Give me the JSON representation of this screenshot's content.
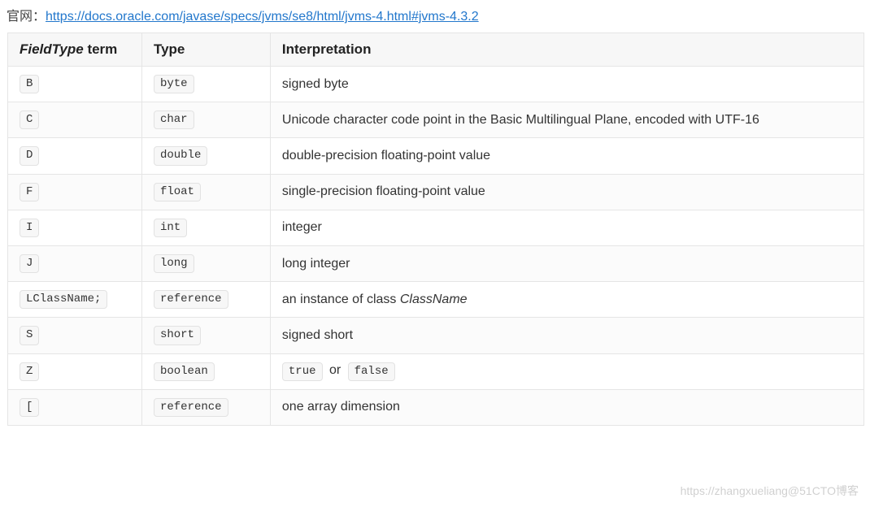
{
  "intro": {
    "prefix": "官网：",
    "link_text": "https://docs.oracle.com/javase/specs/jvms/se8/html/jvms-4.html#jvms-4.3.2",
    "link_href": "https://docs.oracle.com/javase/specs/jvms/se8/html/jvms-4.html#jvms-4.3.2"
  },
  "table": {
    "headers": {
      "col1_italic": "FieldType",
      "col1_rest": " term",
      "col2": "Type",
      "col3": "Interpretation"
    },
    "rows": [
      {
        "term": "B",
        "type": "byte",
        "interp": [
          {
            "t": "text",
            "v": "signed byte"
          }
        ]
      },
      {
        "term": "C",
        "type": "char",
        "interp": [
          {
            "t": "text",
            "v": "Unicode character code point in the Basic Multilingual Plane, encoded with UTF-16"
          }
        ]
      },
      {
        "term": "D",
        "type": "double",
        "interp": [
          {
            "t": "text",
            "v": "double-precision floating-point value"
          }
        ]
      },
      {
        "term": "F",
        "type": "float",
        "interp": [
          {
            "t": "text",
            "v": "single-precision floating-point value"
          }
        ]
      },
      {
        "term": "I",
        "type": "int",
        "interp": [
          {
            "t": "text",
            "v": "integer"
          }
        ]
      },
      {
        "term": "J",
        "type": "long",
        "interp": [
          {
            "t": "text",
            "v": "long integer"
          }
        ]
      },
      {
        "term": "LClassName;",
        "type": "reference",
        "interp": [
          {
            "t": "text",
            "v": "an instance of class "
          },
          {
            "t": "em",
            "v": "ClassName"
          }
        ]
      },
      {
        "term": "S",
        "type": "short",
        "interp": [
          {
            "t": "text",
            "v": "signed short"
          }
        ]
      },
      {
        "term": "Z",
        "type": "boolean",
        "interp": [
          {
            "t": "code",
            "v": "true"
          },
          {
            "t": "or",
            "v": " or "
          },
          {
            "t": "code",
            "v": "false"
          }
        ]
      },
      {
        "term": "[",
        "type": "reference",
        "interp": [
          {
            "t": "text",
            "v": "one array dimension"
          }
        ]
      }
    ]
  },
  "watermark": "https://zhangxueliang@51CTO博客"
}
